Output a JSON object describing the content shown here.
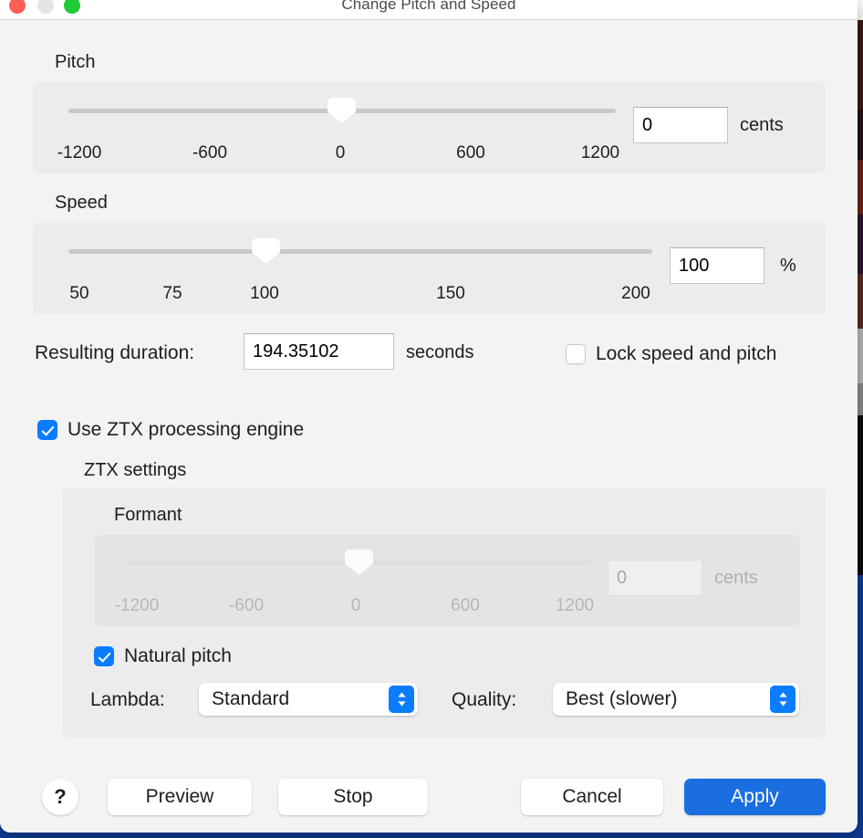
{
  "window": {
    "title": "Change Pitch and Speed",
    "traffic_lights": [
      "close",
      "minimize",
      "maximize"
    ],
    "accent_color": "#0a7cff",
    "default_button_color": "#1a6ee0"
  },
  "pitch": {
    "label": "Pitch",
    "ticks": [
      "-1200",
      "-600",
      "0",
      "600",
      "1200"
    ],
    "value": "0",
    "unit": "cents",
    "thumb_percent": 50
  },
  "speed": {
    "label": "Speed",
    "ticks": [
      "50",
      "75",
      "100",
      "150",
      "200"
    ],
    "value": "100",
    "unit": "%",
    "thumb_percent": 33
  },
  "duration": {
    "label": "Resulting duration:",
    "value": "194.35102",
    "unit": "seconds"
  },
  "lock": {
    "label": "Lock speed and pitch",
    "checked": false
  },
  "ztx": {
    "use_engine_label": "Use ZTX processing engine",
    "use_engine_checked": true,
    "settings_label": "ZTX settings",
    "formant": {
      "label": "Formant",
      "ticks": [
        "-1200",
        "-600",
        "0",
        "600",
        "1200"
      ],
      "value": "0",
      "unit": "cents",
      "enabled": false,
      "thumb_percent": 50
    },
    "natural_pitch": {
      "label": "Natural pitch",
      "checked": true
    },
    "lambda": {
      "label": "Lambda:",
      "value": "Standard"
    },
    "quality": {
      "label": "Quality:",
      "value": "Best (slower)"
    }
  },
  "buttons": {
    "help": "?",
    "preview": "Preview",
    "stop": "Stop",
    "cancel": "Cancel",
    "apply": "Apply"
  }
}
